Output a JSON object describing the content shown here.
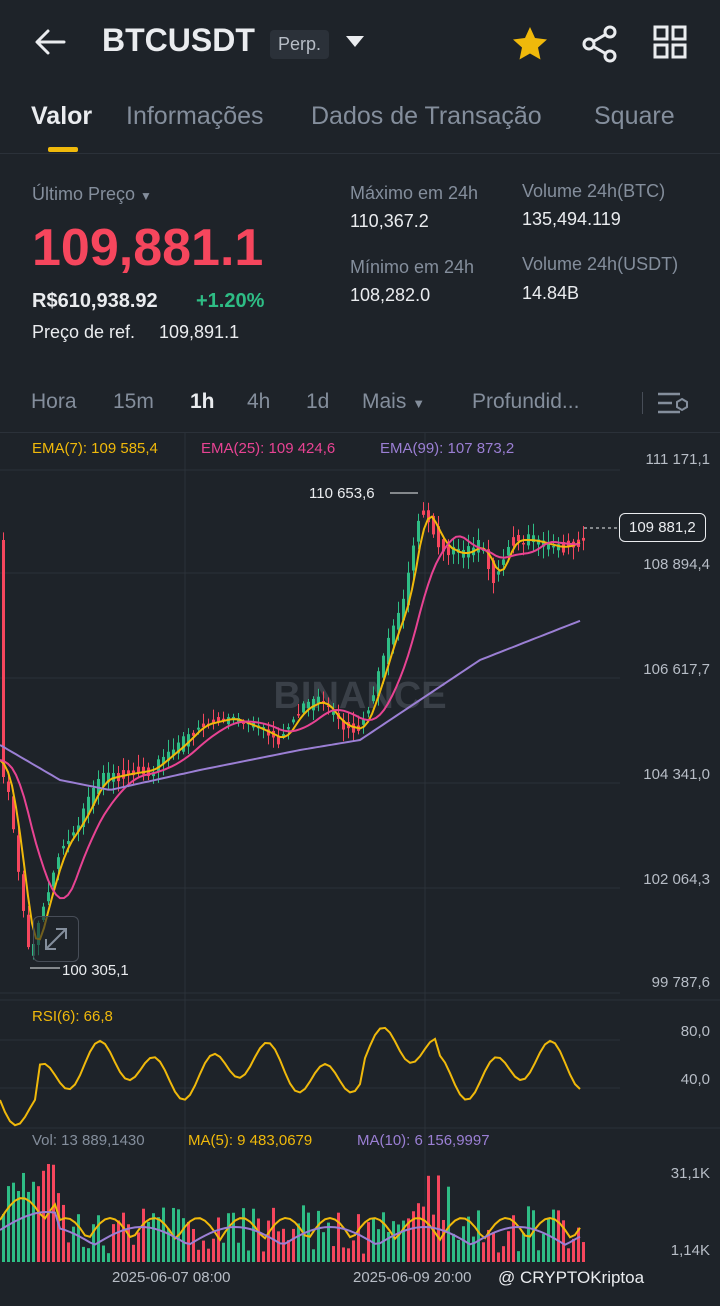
{
  "header": {
    "symbol": "BTCUSDT",
    "contract": "Perp."
  },
  "tabs": [
    {
      "label": "Valor",
      "active": true
    },
    {
      "label": "Informações"
    },
    {
      "label": "Dados de Transação"
    },
    {
      "label": "Square"
    }
  ],
  "price": {
    "last_label": "Último Preço",
    "last": "109,881.1",
    "brl": "R$610,938.92",
    "change": "+1.20%",
    "ref_label": "Preço de ref.",
    "ref": "109,891.1"
  },
  "stats": {
    "high_label": "Máximo em 24h",
    "high": "110,367.2",
    "low_label": "Mínimo em 24h",
    "low": "108,282.0",
    "vol_btc_label": "Volume 24h(BTC)",
    "vol_btc": "135,494.119",
    "vol_usdt_label": "Volume 24h(USDT)",
    "vol_usdt": "14.84B"
  },
  "timeframes": [
    {
      "label": "Hora"
    },
    {
      "label": "15m"
    },
    {
      "label": "1h",
      "active": true
    },
    {
      "label": "4h"
    },
    {
      "label": "1d"
    },
    {
      "label": "Mais"
    },
    {
      "label": "Profundid..."
    }
  ],
  "indicators": {
    "ema7": "EMA(7): 109 585,4",
    "ema25": "EMA(25): 109 424,6",
    "ema99": "EMA(99): 107 873,2",
    "rsi": "RSI(6): 66,8",
    "vol": "Vol: 13 889,1430",
    "ma5": "MA(5): 9 483,0679",
    "ma10": "MA(10): 6 156,9997"
  },
  "price_axis": [
    "111 171,1",
    "108 894,4",
    "106 617,7",
    "104 341,0",
    "102 064,3",
    "99 787,6"
  ],
  "rsi_axis": [
    "80,0",
    "40,0"
  ],
  "vol_axis": [
    "31,1K",
    "1,14K"
  ],
  "annotations": {
    "high_marker": "110 653,6",
    "low_marker": "100 305,1",
    "current_tag": "109 881,2"
  },
  "time_axis": [
    "2025-06-07 08:00",
    "2025-06-09 20:00"
  ],
  "watermark": "BINANCE",
  "footer_credit": "@ CRYPTOKriptoa",
  "colors": {
    "up": "#2ebd85",
    "down": "#f6465d",
    "ema7": "#f0b90b",
    "ema25": "#e84393",
    "ema99": "#9b7fd4",
    "accent": "#f0b90b"
  }
}
